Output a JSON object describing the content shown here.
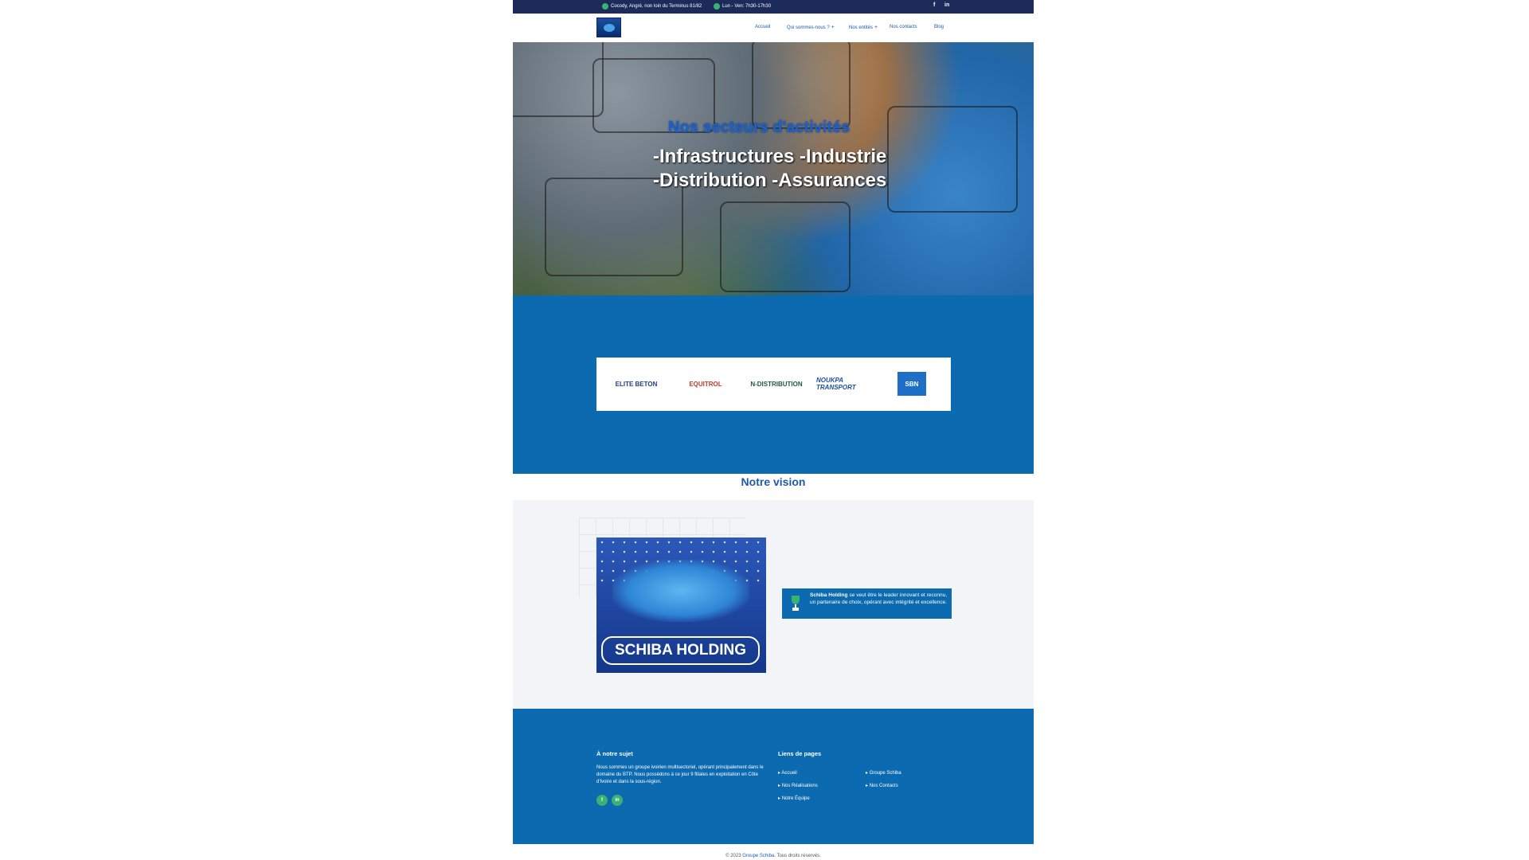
{
  "topbar": {
    "address": "Cocody, Angré, non loin du Terminus 81/82",
    "hours": "Lun - Ven: 7h30-17h30",
    "social": [
      "f",
      "in"
    ]
  },
  "header": {
    "nav": [
      "Accueil",
      "Qui sommes-nous ?",
      "Nos entités",
      "Nos contacts",
      "Blog"
    ]
  },
  "hero": {
    "title": "Nos secteurs d'activités",
    "line1": "-Infrastructures -Industrie",
    "line2": "-Distribution -Assurances"
  },
  "partners": [
    "ELITE BETON",
    "EQUITROL",
    "N-DISTRIBUTION",
    "NOUKPA TRANSPORT",
    "SBN"
  ],
  "vision": {
    "title": "Notre vision",
    "image_label": "SCHIBA HOLDING",
    "text_bold": "Schiba Holding",
    "text_rest": " se veut être le leader innovant et reconnu, un partenaire de choix, opérant avec intégrité et excellence."
  },
  "footer": {
    "about_title": "À notre sujet",
    "about_text": "Nous sommes un groupe ivoirien multisectoriel, opérant principalement dans le domaine du BTP. Nous possédons à ce jour 9 filiales en exploitation en Côte d'Ivoire et dans la sous-région.",
    "social": [
      "f",
      "in"
    ],
    "links_title": "Liens de pages",
    "links": [
      "Accueil",
      "Groupe Schiba",
      "Nos Réalisations",
      "Nos Contacts",
      "Notre Équipe"
    ]
  },
  "copyright": {
    "prefix": "© 2023",
    "brand": "Groupe Schiba",
    "suffix": ". Tous droits réservés."
  },
  "colors": {
    "topbar": "#1d2b5a",
    "primary_blue": "#0b6ab0",
    "accent_green": "#3bb273",
    "light_bg": "#f2f4f7"
  }
}
